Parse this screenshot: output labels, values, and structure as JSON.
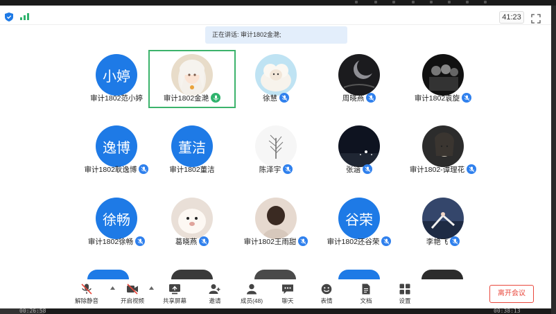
{
  "window": {
    "timer": "41:23",
    "banner": "正在讲话: 审计1802金滟;"
  },
  "participants": [
    {
      "name": "审计1802范小婷",
      "avatar_text": "小婷",
      "avatar_kind": "text",
      "mic": "none"
    },
    {
      "name": "审计1802金滟",
      "avatar_kind": "photo-anime-girl",
      "mic": "speaking",
      "active": true
    },
    {
      "name": "徐慧",
      "avatar_kind": "photo-sheep",
      "mic": "muted"
    },
    {
      "name": "周晓燕",
      "avatar_kind": "photo-dark-moon",
      "mic": "muted"
    },
    {
      "name": "审计1802袁旋",
      "avatar_kind": "photo-group-dark",
      "mic": "muted"
    },
    {
      "name": "审计1802耿逸博",
      "avatar_text": "逸博",
      "avatar_kind": "text",
      "mic": "muted"
    },
    {
      "name": "审计1802董洁",
      "avatar_text": "董洁",
      "avatar_kind": "text",
      "mic": "none"
    },
    {
      "name": "陈泽宇",
      "avatar_kind": "photo-tree",
      "mic": "muted"
    },
    {
      "name": "张涵",
      "avatar_kind": "photo-night-city",
      "mic": "muted"
    },
    {
      "name": "审计1802-谭理花",
      "avatar_kind": "photo-sketch-girl",
      "mic": "muted"
    },
    {
      "name": "审计1802徐畅",
      "avatar_text": "徐畅",
      "avatar_kind": "text",
      "mic": "muted"
    },
    {
      "name": "葛晓燕",
      "avatar_kind": "photo-dog",
      "mic": "muted"
    },
    {
      "name": "审计1802王雨甜",
      "avatar_kind": "photo-girl-back",
      "mic": "muted"
    },
    {
      "name": "审计1802还谷荣",
      "avatar_text": "谷荣",
      "avatar_kind": "text",
      "mic": "muted"
    },
    {
      "name": "李艳飞",
      "avatar_kind": "photo-anime-sky",
      "mic": "muted"
    }
  ],
  "toolbar": {
    "mute_label": "解除静音",
    "video_label": "开启视频",
    "share_label": "共享屏幕",
    "invite_label": "邀请",
    "members_label": "成员(48)",
    "chat_label": "聊天",
    "reactions_label": "表情",
    "docs_label": "文档",
    "settings_label": "设置",
    "leave_label": "离开会议"
  },
  "player": {
    "elapsed": "00:26:58",
    "total": "00:38:13",
    "played_fraction": 0.08
  },
  "colors": {
    "accent_blue": "#1e7ae6",
    "speaking_green": "#3bb36b",
    "leave_red": "#e9473b"
  },
  "icons": [
    "shield-icon",
    "signal-icon",
    "fullscreen-icon",
    "mic-muted-icon",
    "camera-off-icon",
    "share-screen-icon",
    "invite-icon",
    "members-icon",
    "chat-icon",
    "reactions-icon",
    "docs-icon",
    "settings-icon"
  ]
}
